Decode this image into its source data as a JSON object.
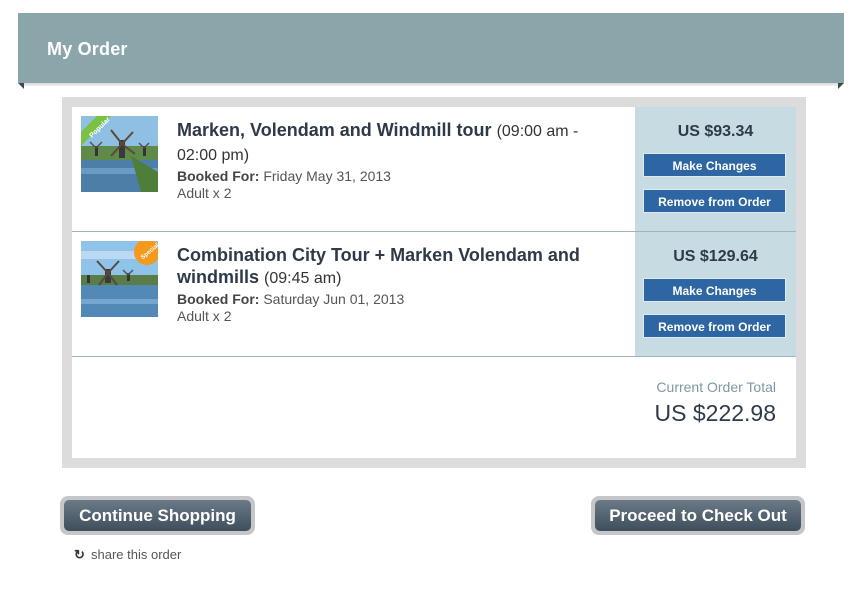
{
  "header": {
    "title": "My Order"
  },
  "items": [
    {
      "title": "Marken, Volendam and Windmill tour",
      "time": "(09:00 am - 02:00 pm)",
      "booked_label": "Booked For:",
      "booked_date": "Friday May 31, 2013",
      "quantity": "Adult x 2",
      "price": "US $93.34",
      "badge": "Popular",
      "change_label": "Make Changes",
      "remove_label": "Remove from Order"
    },
    {
      "title": "Combination City Tour + Marken Volendam and windmills",
      "time": "(09:45 am)",
      "booked_label": "Booked For:",
      "booked_date": "Saturday Jun 01, 2013",
      "quantity": "Adult x 2",
      "price": "US $129.64",
      "badge": "Special",
      "change_label": "Make Changes",
      "remove_label": "Remove from Order"
    }
  ],
  "totals": {
    "label": "Current Order Total",
    "value": "US $222.98"
  },
  "actions": {
    "continue_label": "Continue Shopping",
    "checkout_label": "Proceed to Check Out",
    "share_label": "share this order"
  },
  "colors": {
    "header": "#8ba6ab",
    "button": "#2d66a2",
    "price_panel": "#c7dbe2",
    "popular_badge": "#7cc242",
    "special_badge": "#f39a1e"
  }
}
